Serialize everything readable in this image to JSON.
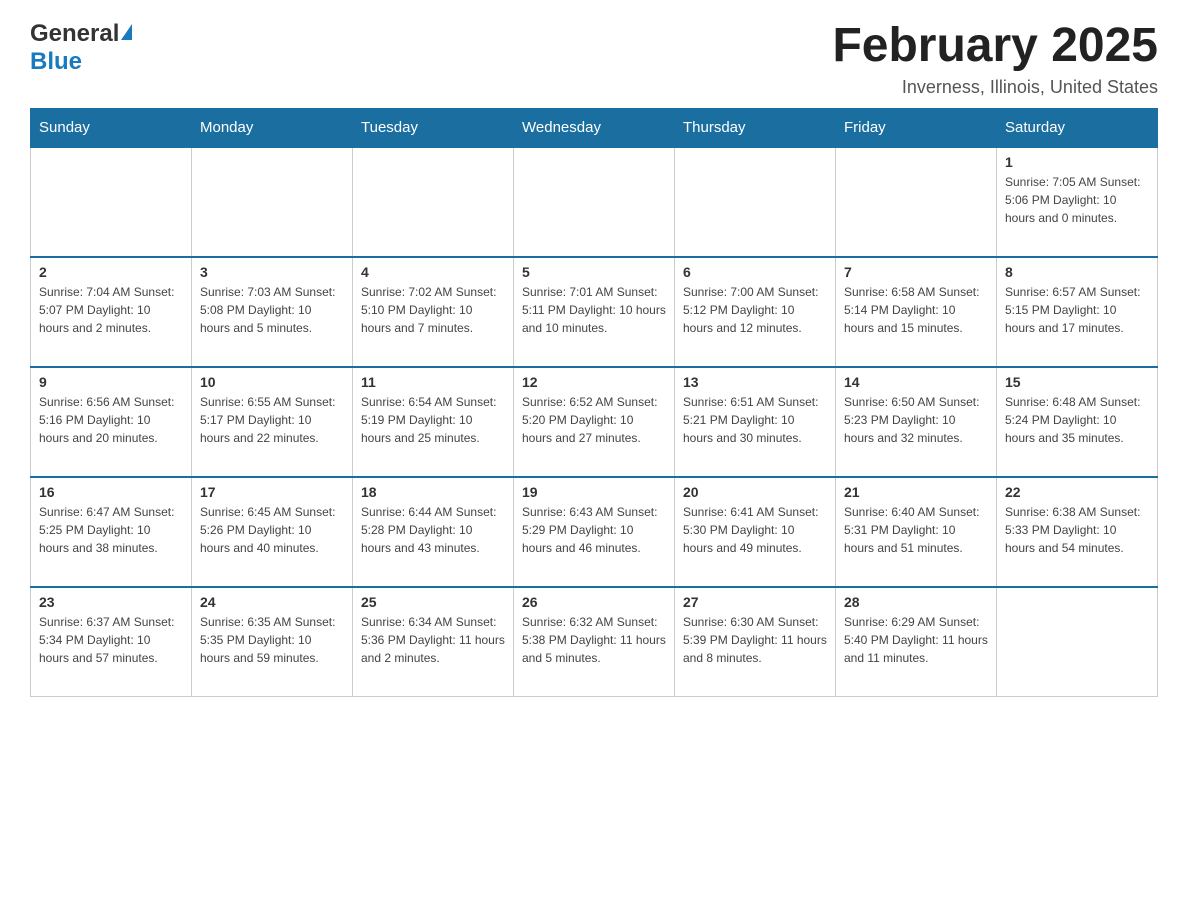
{
  "header": {
    "logo_general": "General",
    "logo_blue": "Blue",
    "month_title": "February 2025",
    "location": "Inverness, Illinois, United States"
  },
  "weekdays": [
    "Sunday",
    "Monday",
    "Tuesday",
    "Wednesday",
    "Thursday",
    "Friday",
    "Saturday"
  ],
  "weeks": [
    [
      {
        "day": "",
        "info": ""
      },
      {
        "day": "",
        "info": ""
      },
      {
        "day": "",
        "info": ""
      },
      {
        "day": "",
        "info": ""
      },
      {
        "day": "",
        "info": ""
      },
      {
        "day": "",
        "info": ""
      },
      {
        "day": "1",
        "info": "Sunrise: 7:05 AM\nSunset: 5:06 PM\nDaylight: 10 hours and 0 minutes."
      }
    ],
    [
      {
        "day": "2",
        "info": "Sunrise: 7:04 AM\nSunset: 5:07 PM\nDaylight: 10 hours and 2 minutes."
      },
      {
        "day": "3",
        "info": "Sunrise: 7:03 AM\nSunset: 5:08 PM\nDaylight: 10 hours and 5 minutes."
      },
      {
        "day": "4",
        "info": "Sunrise: 7:02 AM\nSunset: 5:10 PM\nDaylight: 10 hours and 7 minutes."
      },
      {
        "day": "5",
        "info": "Sunrise: 7:01 AM\nSunset: 5:11 PM\nDaylight: 10 hours and 10 minutes."
      },
      {
        "day": "6",
        "info": "Sunrise: 7:00 AM\nSunset: 5:12 PM\nDaylight: 10 hours and 12 minutes."
      },
      {
        "day": "7",
        "info": "Sunrise: 6:58 AM\nSunset: 5:14 PM\nDaylight: 10 hours and 15 minutes."
      },
      {
        "day": "8",
        "info": "Sunrise: 6:57 AM\nSunset: 5:15 PM\nDaylight: 10 hours and 17 minutes."
      }
    ],
    [
      {
        "day": "9",
        "info": "Sunrise: 6:56 AM\nSunset: 5:16 PM\nDaylight: 10 hours and 20 minutes."
      },
      {
        "day": "10",
        "info": "Sunrise: 6:55 AM\nSunset: 5:17 PM\nDaylight: 10 hours and 22 minutes."
      },
      {
        "day": "11",
        "info": "Sunrise: 6:54 AM\nSunset: 5:19 PM\nDaylight: 10 hours and 25 minutes."
      },
      {
        "day": "12",
        "info": "Sunrise: 6:52 AM\nSunset: 5:20 PM\nDaylight: 10 hours and 27 minutes."
      },
      {
        "day": "13",
        "info": "Sunrise: 6:51 AM\nSunset: 5:21 PM\nDaylight: 10 hours and 30 minutes."
      },
      {
        "day": "14",
        "info": "Sunrise: 6:50 AM\nSunset: 5:23 PM\nDaylight: 10 hours and 32 minutes."
      },
      {
        "day": "15",
        "info": "Sunrise: 6:48 AM\nSunset: 5:24 PM\nDaylight: 10 hours and 35 minutes."
      }
    ],
    [
      {
        "day": "16",
        "info": "Sunrise: 6:47 AM\nSunset: 5:25 PM\nDaylight: 10 hours and 38 minutes."
      },
      {
        "day": "17",
        "info": "Sunrise: 6:45 AM\nSunset: 5:26 PM\nDaylight: 10 hours and 40 minutes."
      },
      {
        "day": "18",
        "info": "Sunrise: 6:44 AM\nSunset: 5:28 PM\nDaylight: 10 hours and 43 minutes."
      },
      {
        "day": "19",
        "info": "Sunrise: 6:43 AM\nSunset: 5:29 PM\nDaylight: 10 hours and 46 minutes."
      },
      {
        "day": "20",
        "info": "Sunrise: 6:41 AM\nSunset: 5:30 PM\nDaylight: 10 hours and 49 minutes."
      },
      {
        "day": "21",
        "info": "Sunrise: 6:40 AM\nSunset: 5:31 PM\nDaylight: 10 hours and 51 minutes."
      },
      {
        "day": "22",
        "info": "Sunrise: 6:38 AM\nSunset: 5:33 PM\nDaylight: 10 hours and 54 minutes."
      }
    ],
    [
      {
        "day": "23",
        "info": "Sunrise: 6:37 AM\nSunset: 5:34 PM\nDaylight: 10 hours and 57 minutes."
      },
      {
        "day": "24",
        "info": "Sunrise: 6:35 AM\nSunset: 5:35 PM\nDaylight: 10 hours and 59 minutes."
      },
      {
        "day": "25",
        "info": "Sunrise: 6:34 AM\nSunset: 5:36 PM\nDaylight: 11 hours and 2 minutes."
      },
      {
        "day": "26",
        "info": "Sunrise: 6:32 AM\nSunset: 5:38 PM\nDaylight: 11 hours and 5 minutes."
      },
      {
        "day": "27",
        "info": "Sunrise: 6:30 AM\nSunset: 5:39 PM\nDaylight: 11 hours and 8 minutes."
      },
      {
        "day": "28",
        "info": "Sunrise: 6:29 AM\nSunset: 5:40 PM\nDaylight: 11 hours and 11 minutes."
      },
      {
        "day": "",
        "info": ""
      }
    ]
  ]
}
